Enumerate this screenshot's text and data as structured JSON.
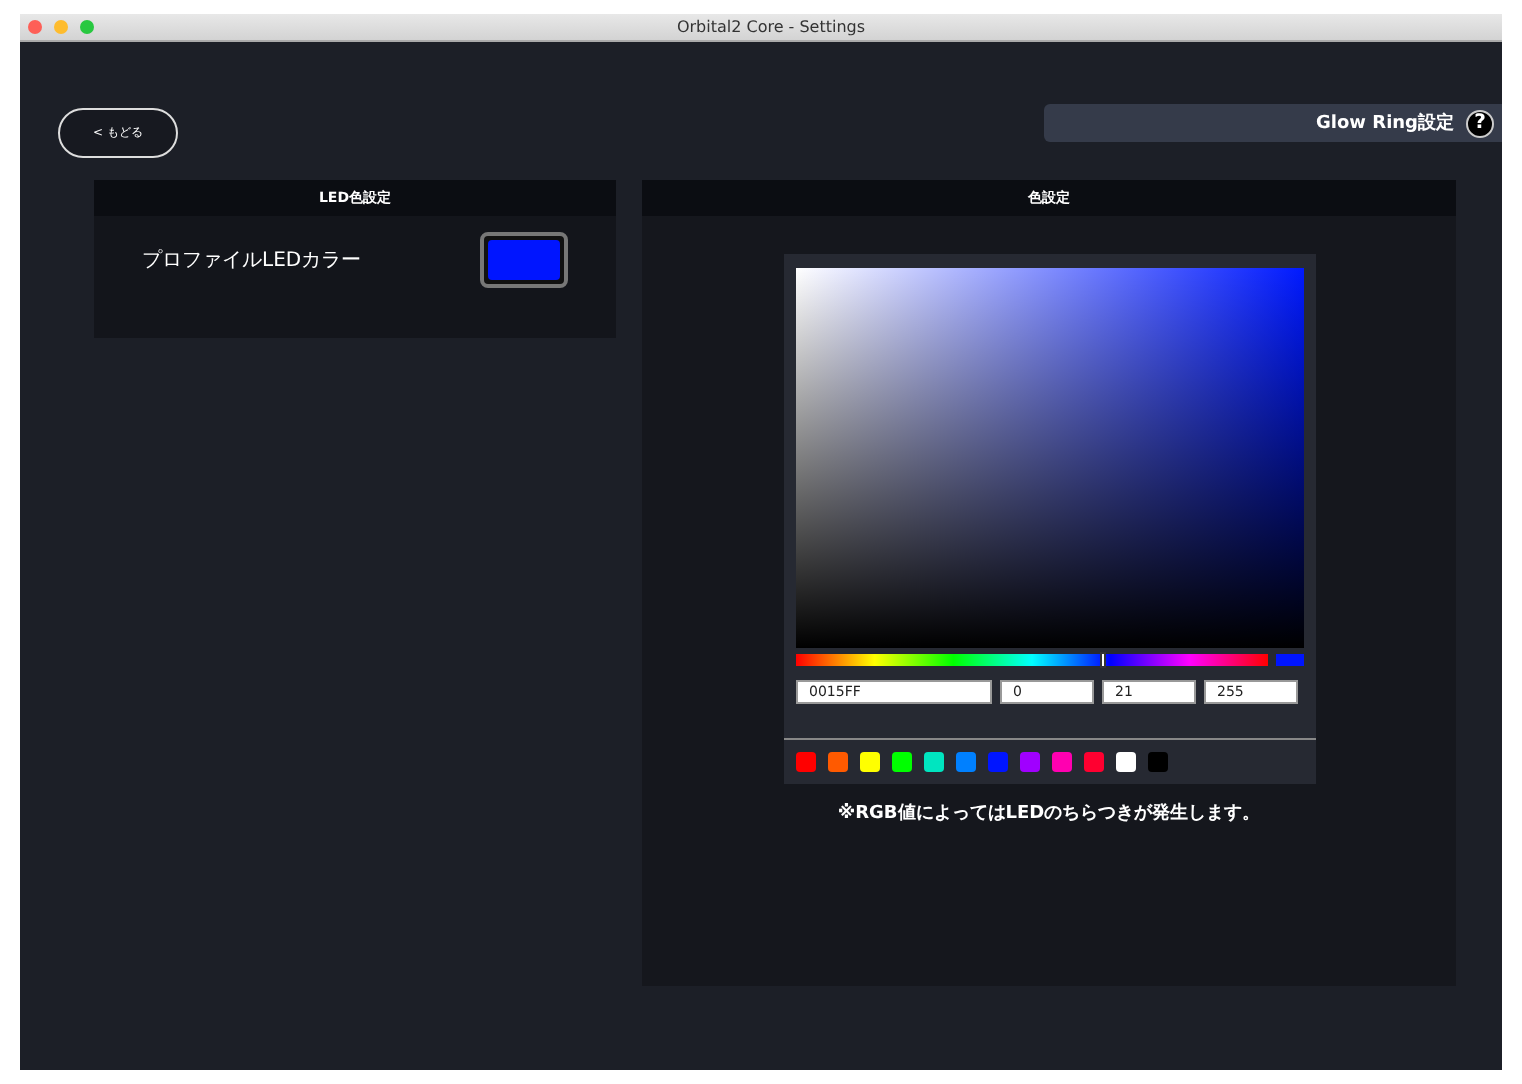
{
  "window": {
    "title": "Orbital2 Core - Settings"
  },
  "back_button": {
    "label": "< もどる"
  },
  "header": {
    "title": "Glow Ring設定",
    "help": "?"
  },
  "led_panel": {
    "title": "LED色設定",
    "label": "プロファイルLEDカラー",
    "color": "#0015ff"
  },
  "color_panel": {
    "title": "色設定",
    "hue_slider": {
      "level": 0.65
    },
    "fields": [
      "0015FF",
      "0",
      "21",
      "255"
    ],
    "swatches": [
      {
        "color": "#ff0000"
      },
      {
        "color": "#ff5a00"
      },
      {
        "color": "#ffff00"
      },
      {
        "color": "#00ff00"
      },
      {
        "color": "#00e5c0"
      },
      {
        "color": "#0080ff"
      },
      {
        "color": "#0015ff"
      },
      {
        "color": "#a000ff"
      },
      {
        "color": "#ff00b0"
      },
      {
        "color": "#ff0030"
      },
      {
        "color": "#ffffff"
      },
      {
        "color": "#000000"
      }
    ],
    "note": "※RGB値によってはLEDのちらつきが発生します。"
  }
}
